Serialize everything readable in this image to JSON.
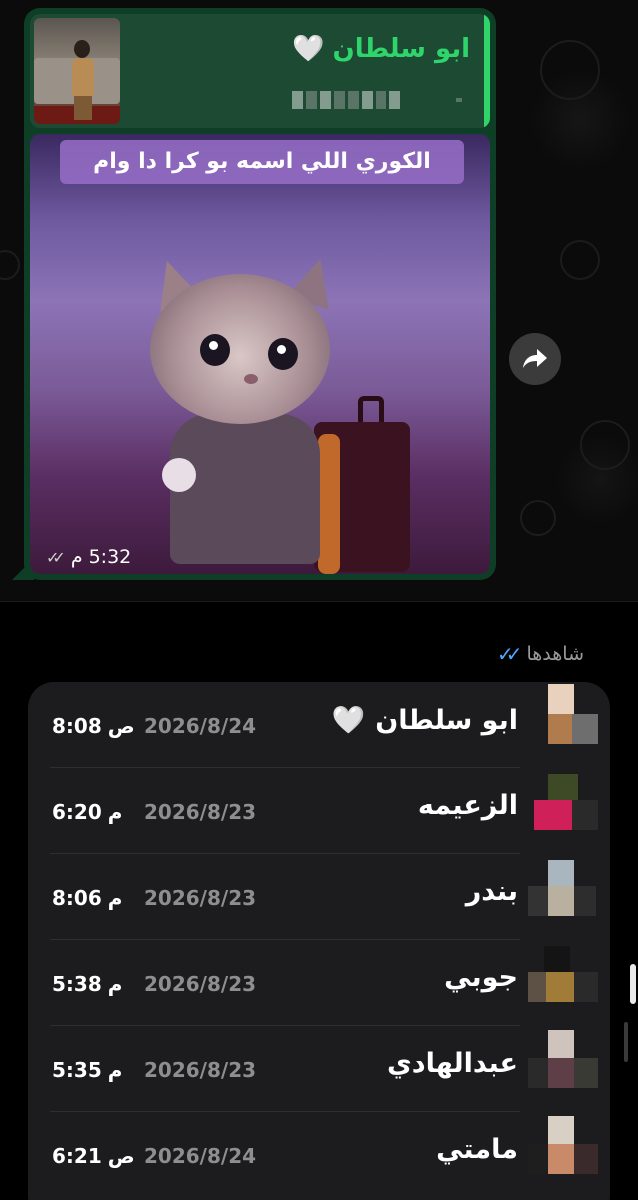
{
  "message": {
    "reply": {
      "sender": "ابو سلطان",
      "heart": "🤍"
    },
    "caption": "الكوري اللي اسمه بو كرا دا وام",
    "time": "5:32",
    "time_suffix": "م",
    "ticks": "✓✓"
  },
  "seen": {
    "title": "شاهدها",
    "ticks": "✓✓"
  },
  "viewers": [
    {
      "name": "ابو سلطان",
      "heart": "🤍",
      "date": "2026/8/24",
      "time": "8:08",
      "suffix": "ص"
    },
    {
      "name": "الزعيمه",
      "heart": "",
      "date": "2026/8/23",
      "time": "6:20",
      "suffix": "م"
    },
    {
      "name": "بندر",
      "heart": "",
      "date": "2026/8/23",
      "time": "8:06",
      "suffix": "م"
    },
    {
      "name": "جوبي",
      "heart": "",
      "date": "2026/8/23",
      "time": "5:38",
      "suffix": "م"
    },
    {
      "name": "عبدالهادي",
      "heart": "",
      "date": "2026/8/23",
      "time": "5:35",
      "suffix": "م"
    },
    {
      "name": "مامتي",
      "heart": "",
      "date": "2026/8/24",
      "time": "6:21",
      "suffix": "ص"
    }
  ],
  "colors": {
    "sender_green": "#2fd46b",
    "bubble_bg": "#0f3e26",
    "seen_tick_blue": "#4ea8ff",
    "card_bg": "#1c1c1e"
  },
  "icons": {
    "forward": "forward-arrow-icon",
    "heart": "white-heart-icon"
  }
}
